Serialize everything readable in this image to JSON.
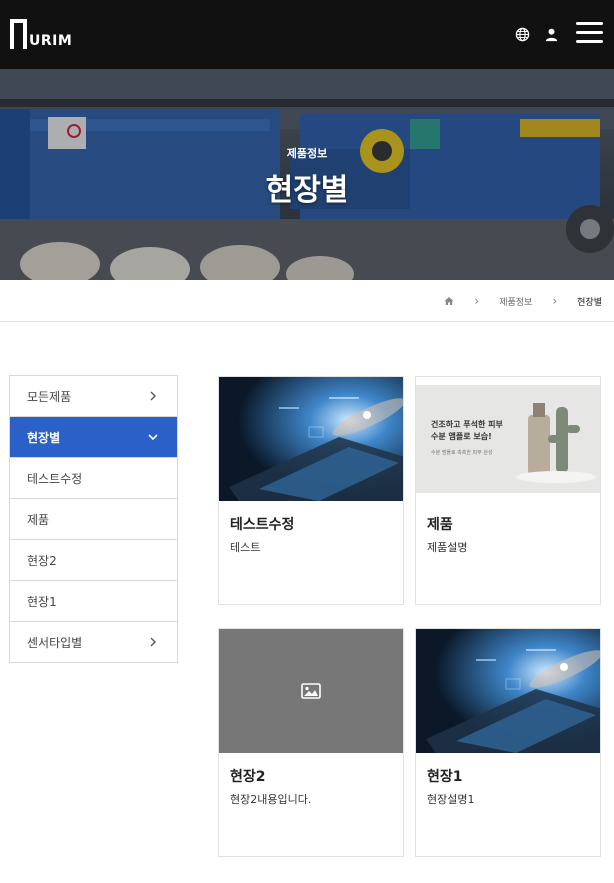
{
  "header": {
    "logo_text": "URIM",
    "icons": [
      "globe-icon",
      "user-icon",
      "hamburger-menu-icon"
    ],
    "background": "#111111"
  },
  "hero": {
    "subtitle": "제품정보",
    "title": "현장별"
  },
  "breadcrumb": {
    "home_icon": "home-icon",
    "items": [
      "제품정보",
      "현장별"
    ]
  },
  "sidebar": {
    "accent": "#2b60c8",
    "items": [
      {
        "label": "모든제품",
        "icon": "chevron-right-icon"
      },
      {
        "label": "현장별",
        "icon": "chevron-down-icon",
        "active": true
      },
      {
        "label": "테스트수정"
      },
      {
        "label": "제품"
      },
      {
        "label": "현장2"
      },
      {
        "label": "현장1"
      },
      {
        "label": "센서타입별",
        "icon": "chevron-right-icon"
      }
    ]
  },
  "cards": [
    {
      "title": "테스트수정",
      "desc": "테스트",
      "thumb": "tablet-touch-photo"
    },
    {
      "title": "제품",
      "desc": "제품설명",
      "thumb": "cosmetic-banner",
      "banner_line1": "건조하고 푸석한 피부",
      "banner_line2": "수분 앰플로 보습!",
      "banner_small": "수분 앰플로 촉촉한 피부 완성"
    },
    {
      "title": "현장2",
      "desc": "현장2내용입니다.",
      "thumb": "image-placeholder-icon"
    },
    {
      "title": "현장1",
      "desc": "현장설명1",
      "thumb": "tablet-touch-photo"
    }
  ]
}
